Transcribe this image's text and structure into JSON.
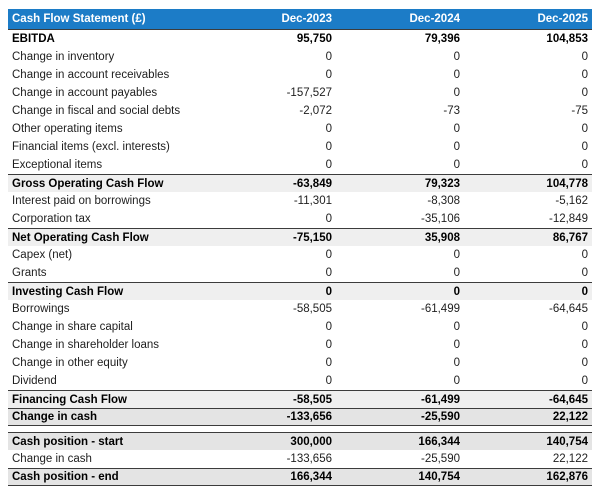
{
  "chart_data": {
    "type": "table",
    "title": "Cash Flow Statement (£)",
    "columns": [
      "Dec-2023",
      "Dec-2024",
      "Dec-2025"
    ],
    "rows": [
      {
        "label": "EBITDA",
        "values": [
          "95,750",
          "79,396",
          "104,853"
        ],
        "style": "bold"
      },
      {
        "label": "Change in inventory",
        "values": [
          "0",
          "0",
          "0"
        ],
        "style": "normal"
      },
      {
        "label": "Change in account receivables",
        "values": [
          "0",
          "0",
          "0"
        ],
        "style": "normal"
      },
      {
        "label": "Change in account payables",
        "values": [
          "-157,527",
          "0",
          "0"
        ],
        "style": "normal"
      },
      {
        "label": "Change in fiscal and social debts",
        "values": [
          "-2,072",
          "-73",
          "-75"
        ],
        "style": "normal"
      },
      {
        "label": "Other operating items",
        "values": [
          "0",
          "0",
          "0"
        ],
        "style": "normal"
      },
      {
        "label": "Financial items (excl. interests)",
        "values": [
          "0",
          "0",
          "0"
        ],
        "style": "normal"
      },
      {
        "label": "Exceptional items",
        "values": [
          "0",
          "0",
          "0"
        ],
        "style": "normal"
      },
      {
        "label": "Gross Operating Cash Flow",
        "values": [
          "-63,849",
          "79,323",
          "104,778"
        ],
        "style": "subtotal"
      },
      {
        "label": "Interest paid on borrowings",
        "values": [
          "-11,301",
          "-8,308",
          "-5,162"
        ],
        "style": "normal"
      },
      {
        "label": "Corporation tax",
        "values": [
          "0",
          "-35,106",
          "-12,849"
        ],
        "style": "normal"
      },
      {
        "label": "Net Operating Cash Flow",
        "values": [
          "-75,150",
          "35,908",
          "86,767"
        ],
        "style": "subtotal"
      },
      {
        "label": "Capex (net)",
        "values": [
          "0",
          "0",
          "0"
        ],
        "style": "normal"
      },
      {
        "label": "Grants",
        "values": [
          "0",
          "0",
          "0"
        ],
        "style": "normal"
      },
      {
        "label": "Investing Cash Flow",
        "values": [
          "0",
          "0",
          "0"
        ],
        "style": "subtotal"
      },
      {
        "label": "Borrowings",
        "values": [
          "-58,505",
          "-61,499",
          "-64,645"
        ],
        "style": "normal"
      },
      {
        "label": "Change in share capital",
        "values": [
          "0",
          "0",
          "0"
        ],
        "style": "normal"
      },
      {
        "label": "Change in shareholder loans",
        "values": [
          "0",
          "0",
          "0"
        ],
        "style": "normal"
      },
      {
        "label": "Change in other equity",
        "values": [
          "0",
          "0",
          "0"
        ],
        "style": "normal"
      },
      {
        "label": "Dividend",
        "values": [
          "0",
          "0",
          "0"
        ],
        "style": "normal"
      },
      {
        "label": "Financing Cash Flow",
        "values": [
          "-58,505",
          "-61,499",
          "-64,645"
        ],
        "style": "subtotal"
      },
      {
        "label": "Change in cash",
        "values": [
          "-133,656",
          "-25,590",
          "22,122"
        ],
        "style": "total",
        "border_bottom": true,
        "gap_after": true
      },
      {
        "label": "Cash position - start",
        "values": [
          "300,000",
          "166,344",
          "140,754"
        ],
        "style": "total"
      },
      {
        "label": "Change in cash",
        "values": [
          "-133,656",
          "-25,590",
          "22,122"
        ],
        "style": "normal"
      },
      {
        "label": "Cash position - end",
        "values": [
          "166,344",
          "140,754",
          "162,876"
        ],
        "style": "total",
        "border_bottom": true
      }
    ]
  },
  "colors": {
    "header_bg": "#1c7cc7",
    "header_text": "#ffffff",
    "subtotal_bg": "#efefef",
    "total_bg": "#e4e4e4",
    "border": "#3c3c3c"
  }
}
